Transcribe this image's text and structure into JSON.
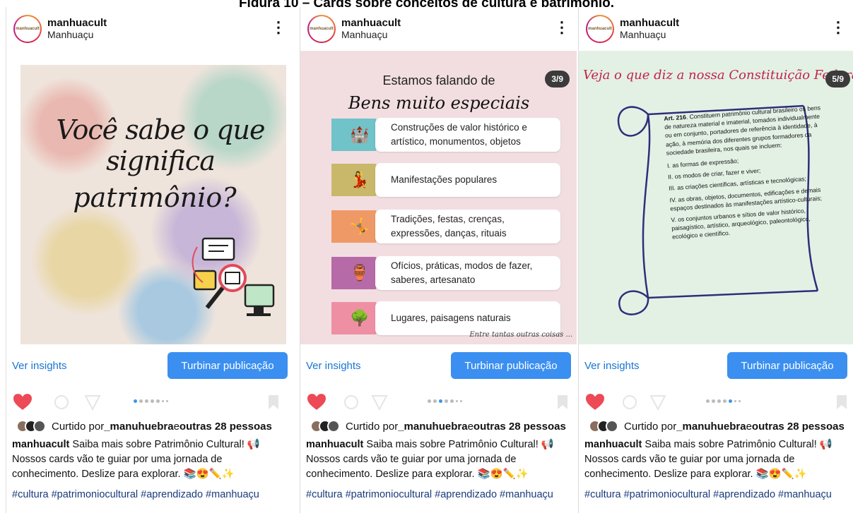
{
  "figure_caption": "Figura 10 – Cards sobre conceitos de cultura e patrimônio.",
  "posts": [
    {
      "username": "manhuacult",
      "location": "Manhuaçu",
      "slide": {
        "line1": "Você sabe o que significa",
        "line2": "patrimônio?"
      },
      "insights_label": "Ver insights",
      "boost_label": "Turbinar publicação",
      "likes_prefix": "Curtido por ",
      "likes_user": "_manuhuebra",
      "likes_mid": " e ",
      "likes_others": "outras 28 pessoas",
      "caption_user": "manhuacult",
      "caption_text": " Saiba mais sobre Patrimônio Cultural! 📢 Nossos cards vão te guiar por uma jornada de conhecimento. Deslize para explorar. 📚😍✏️✨",
      "hashtags": "#cultura #patrimoniocultural #aprendizado #manhuaçu",
      "active_dot": 0
    },
    {
      "username": "manhuacult",
      "location": "Manhuaçu",
      "slide": {
        "counter": "3/9",
        "intro": "Estamos falando de",
        "title": "Bens muito especiais",
        "items": [
          {
            "line1": "Construções de valor histórico e",
            "line2": "artístico, monumentos, objetos",
            "color": "#6fc3c9",
            "icon": "🏰"
          },
          {
            "line1": "Manifestações populares",
            "line2": "",
            "color": "#c9b86a",
            "icon": "💃"
          },
          {
            "line1": "Tradições, festas, crenças,",
            "line2": "expressões, danças, rituais",
            "color": "#ef9966",
            "icon": "🤸"
          },
          {
            "line1": "Ofícios, práticas, modos de fazer,",
            "line2": "saberes, artesanato",
            "color": "#b76aa8",
            "icon": "🏺"
          },
          {
            "line1": "Lugares, paisagens naturais",
            "line2": "",
            "color": "#ef8fa4",
            "icon": "🌳"
          }
        ],
        "footer": "Entre tantas outras coisas ..."
      },
      "insights_label": "Ver insights",
      "boost_label": "Turbinar publicação",
      "likes_prefix": "Curtido por ",
      "likes_user": "_manuhuebra",
      "likes_mid": " e ",
      "likes_others": "outras 28 pessoas",
      "caption_user": "manhuacult",
      "caption_text": " Saiba mais sobre Patrimônio Cultural! 📢 Nossos cards vão te guiar por uma jornada de conhecimento. Deslize para explorar. 📚😍✏️✨",
      "hashtags": "#cultura #patrimoniocultural #aprendizado #manhuaçu",
      "active_dot": 2
    },
    {
      "username": "manhuacult",
      "location": "Manhuaçu",
      "slide": {
        "counter": "5/9",
        "title": "Veja o que diz a nossa Constituição Federal",
        "art_label": "Art. 216",
        "art_text": ". Constituem patrimônio cultural brasileiro os bens de natureza material e imaterial, tomados individualmente ou em conjunto, portadores de referência à identidade, à ação, à memória dos diferentes grupos formadores da sociedade brasileira, nos quais se incluem:",
        "items": [
          "I. as formas de expressão;",
          "II. os modos de criar, fazer e viver;",
          "III. as criações científicas, artísticas e tecnológicas;",
          "IV. as obras, objetos, documentos, edificações e demais espaços destinados às manifestações artístico-culturais;",
          "V. os conjuntos urbanos e sítios de valor histórico, paisagístico, artístico, arqueológico, paleontológico, ecológico e científico."
        ]
      },
      "insights_label": "Ver insights",
      "boost_label": "Turbinar publicação",
      "likes_prefix": "Curtido por ",
      "likes_user": "_manuhuebra",
      "likes_mid": " e ",
      "likes_others": "outras 28 pessoas",
      "caption_user": "manhuacult",
      "caption_text": " Saiba mais sobre Patrimônio Cultural! 📢 Nossos cards vão te guiar por uma jornada de conhecimento. Deslize para explorar. 📚😍✏️✨",
      "hashtags": "#cultura #patrimoniocultural #aprendizado #manhuaçu",
      "active_dot": 4
    }
  ],
  "colors": {
    "link_blue": "#1876d2",
    "boost_blue": "#3b8ff0",
    "heart_red": "#ed4956",
    "carousel_active": "#3897f0"
  }
}
